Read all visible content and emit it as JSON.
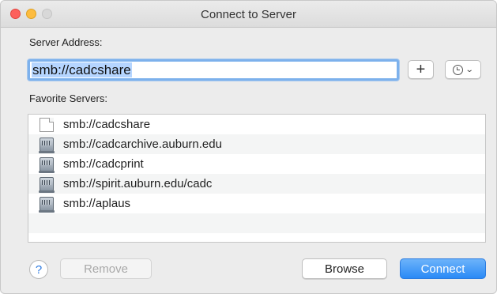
{
  "window": {
    "title": "Connect to Server"
  },
  "server_address": {
    "label": "Server Address:",
    "value": "smb://cadcshare"
  },
  "buttons": {
    "add": "+",
    "help": "?",
    "remove": "Remove",
    "browse": "Browse",
    "connect": "Connect"
  },
  "favorites": {
    "label": "Favorite Servers:",
    "items": [
      {
        "label": "smb://cadcshare",
        "icon": "document-icon"
      },
      {
        "label": "smb://cadcarchive.auburn.edu",
        "icon": "server-icon"
      },
      {
        "label": "smb://cadcprint",
        "icon": "server-icon"
      },
      {
        "label": "smb://spirit.auburn.edu/cadc",
        "icon": "server-icon"
      },
      {
        "label": "smb://aplaus",
        "icon": "server-icon"
      }
    ]
  },
  "colors": {
    "accent": "#2a8af6",
    "selection": "#b5d5ff",
    "close": "#fc605c",
    "minimize": "#fdbc40"
  }
}
